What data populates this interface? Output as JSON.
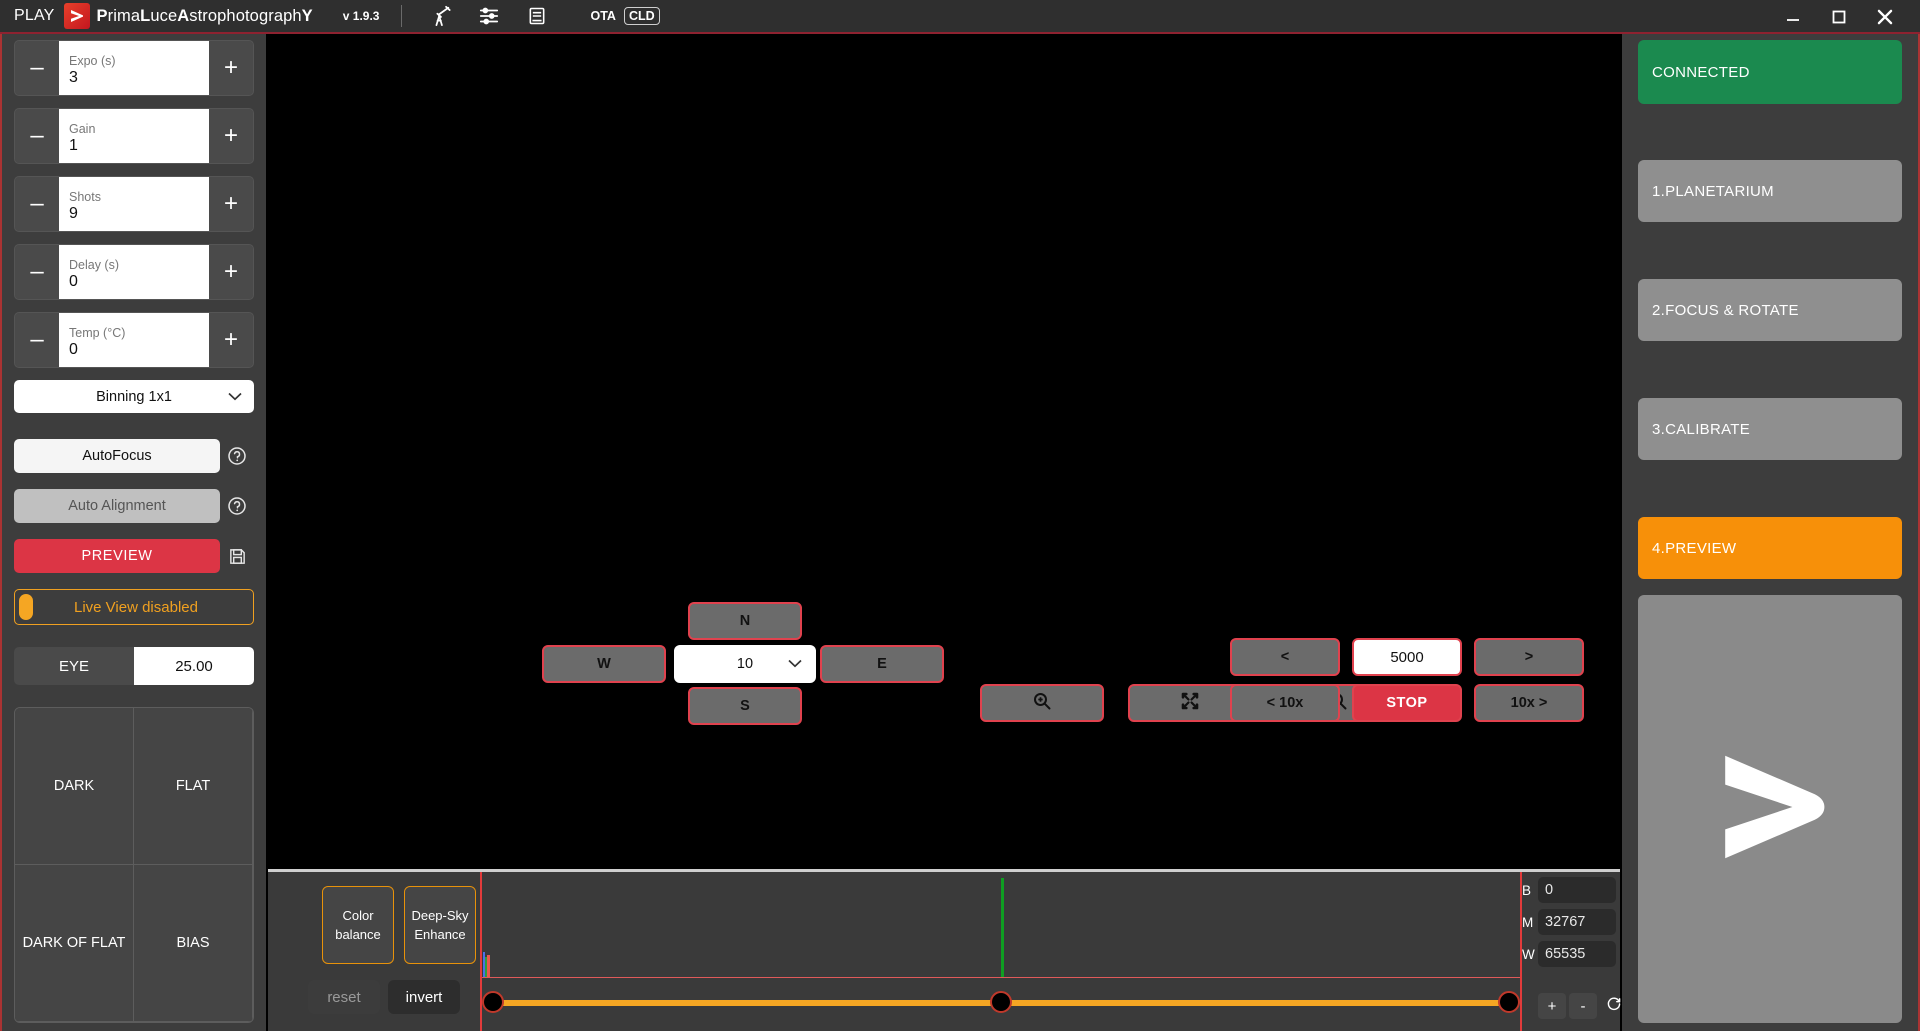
{
  "titlebar": {
    "play_label": "PLAY",
    "app_name_part1": "P",
    "app_name": "PrimaLuceAstrophotographY",
    "version": "v 1.9.3",
    "icons": [
      "telescope-icon",
      "sliders-icon",
      "book-icon"
    ],
    "badge_ota": "OTA",
    "badge_cld": "CLD",
    "window_minimize": "minimize-icon",
    "window_maximize": "maximize-icon",
    "window_close": "close-icon"
  },
  "left_panel": {
    "spinners": [
      {
        "label": "Expo (s)",
        "value": "3",
        "minus": "–",
        "plus": "+"
      },
      {
        "label": "Gain",
        "value": "1",
        "minus": "–",
        "plus": "+"
      },
      {
        "label": "Shots",
        "value": "9",
        "minus": "–",
        "plus": "+"
      },
      {
        "label": "Delay (s)",
        "value": "0",
        "minus": "–",
        "plus": "+"
      },
      {
        "label": "Temp (°C)",
        "value": "0",
        "minus": "–",
        "plus": "+"
      }
    ],
    "binning": {
      "selected": "Binning 1x1"
    },
    "autofocus": "AutoFocus",
    "auto_alignment": "Auto Alignment",
    "preview": "PREVIEW",
    "live_view": "Live View disabled",
    "eye_label": "EYE",
    "eye_value": "25.00",
    "calibration": [
      "DARK",
      "FLAT",
      "DARK OF FLAT",
      "BIAS"
    ]
  },
  "center": {
    "nav": {
      "north": "N",
      "south": "S",
      "west": "W",
      "east": "E",
      "step_selected": "10"
    },
    "zoom_buttons": [
      "zoom-in-icon",
      "fit-screen-icon",
      "zoom-out-icon"
    ],
    "focuser": {
      "prev": "<",
      "next": ">",
      "position": "5000",
      "prev10x": "< 10x",
      "next10x": "10x >",
      "stop": "STOP"
    }
  },
  "histogram": {
    "color_balance": "Color\nbalance",
    "color_balance_line1": "Color",
    "color_balance_line2": "balance",
    "deep_sky_line1": "Deep-Sky",
    "deep_sky_line2": "Enhance",
    "reset": "reset",
    "invert": "invert",
    "levels": [
      {
        "key": "B",
        "value": "0"
      },
      {
        "key": "M",
        "value": "32767"
      },
      {
        "key": "W",
        "value": "65535"
      }
    ],
    "plus": "+",
    "minus": "-",
    "refresh": "refresh-icon"
  },
  "right_panel": {
    "status": "CONNECTED",
    "steps": [
      {
        "label": "1.PLANETARIUM",
        "state": "idle"
      },
      {
        "label": "2.FOCUS & ROTATE",
        "state": "idle"
      },
      {
        "label": "3.CALIBRATE",
        "state": "idle"
      },
      {
        "label": "4.PREVIEW",
        "state": "active"
      }
    ],
    "logo": "primaluce-chevron-logo"
  },
  "colors": {
    "accent_red": "#dc3545",
    "accent_orange": "#f79009",
    "connected_green": "#1b8a4f",
    "border_red": "#e0424e",
    "panel_bg": "#3d3d3d"
  }
}
